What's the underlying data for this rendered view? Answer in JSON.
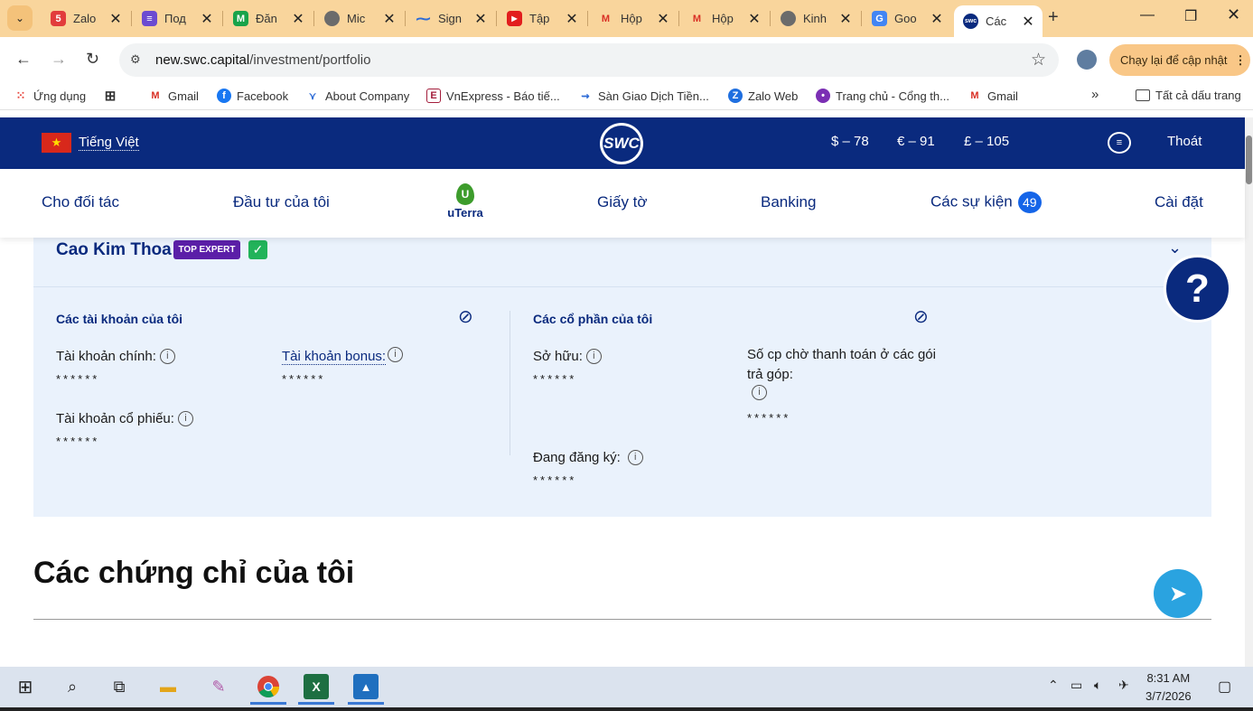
{
  "browser": {
    "tabs": [
      {
        "label": "Zalo",
        "badge": "5+",
        "color": "#e23c3c"
      },
      {
        "label": "Под",
        "color": "#6c4bd1"
      },
      {
        "label": "Đăn",
        "color": "#19a34a"
      },
      {
        "label": "Mic",
        "color": "#6b6b6b"
      },
      {
        "label": "Sign",
        "color": "#2d6bd6"
      },
      {
        "label": "Tập",
        "color": "#e21d1d"
      },
      {
        "label": "Hộp",
        "color": "#d93025"
      },
      {
        "label": "Hộp",
        "color": "#d93025"
      },
      {
        "label": "Kinh",
        "color": "#6b6b6b"
      },
      {
        "label": "Goo",
        "color": "#4285f4"
      },
      {
        "label": "Các",
        "color": "#0a2a7e",
        "active": true
      }
    ],
    "url_host": "new.swc.capital",
    "url_path": "/investment/portfolio",
    "update_button": "Chạy lại để cập nhật",
    "bookmarks": [
      {
        "label": "Ứng dụng",
        "icon": "apps-grid-icon"
      },
      {
        "label": "Gmail",
        "icon": "gmail-icon"
      },
      {
        "label": "Facebook",
        "icon": "facebook-icon"
      },
      {
        "label": "About Company",
        "icon": "company-icon"
      },
      {
        "label": "VnExpress - Báo tiế...",
        "icon": "vnexpress-icon"
      },
      {
        "label": "Sàn Giao Dịch Tiền...",
        "icon": "exchange-icon"
      },
      {
        "label": "Zalo Web",
        "icon": "zalo-icon"
      },
      {
        "label": "Trang chủ - Cổng th...",
        "icon": "portal-icon"
      },
      {
        "label": "Gmail",
        "icon": "gmail-icon"
      }
    ],
    "bookmarks_overflow": "»",
    "all_bookmarks": "Tất cả dấu trang"
  },
  "site": {
    "language": "Tiếng Việt",
    "logo": "SWC",
    "rates": [
      "$ – 78",
      "€ – 91",
      "£ – 105"
    ],
    "logout": "Thoát",
    "nav": {
      "partners": "Cho đối tác",
      "my_investments": "Đầu tư của tôi",
      "uterra": "uTerra",
      "documents": "Giấy tờ",
      "banking": "Banking",
      "events": "Các sự kiện",
      "events_count": "49",
      "settings": "Cài đặt"
    }
  },
  "profile": {
    "name": "Cao Kim Thoa",
    "badge": "TOP EXPERT"
  },
  "accounts": {
    "title": "Các tài khoản của tôi",
    "main_label": "Tài khoản chính:",
    "main_value": "******",
    "bonus_label": "Tài khoản bonus:",
    "bonus_value": "******",
    "stock_label": "Tài khoản cổ phiếu:",
    "stock_value": "******"
  },
  "shares": {
    "title": "Các cổ phần của tôi",
    "owned_label": "Sở hữu:",
    "owned_value": "******",
    "pending_label_1": "Số cp chờ thanh toán ở các gói",
    "pending_label_2": "trả góp:",
    "pending_value": "******",
    "registering_label": "Đang đăng ký:",
    "registering_value": "******"
  },
  "certificates": {
    "title": "Các chứng chỉ của tôi"
  },
  "help_label": "?",
  "taskbar": {
    "time": "8:31 AM",
    "date": "3/7/2026"
  }
}
